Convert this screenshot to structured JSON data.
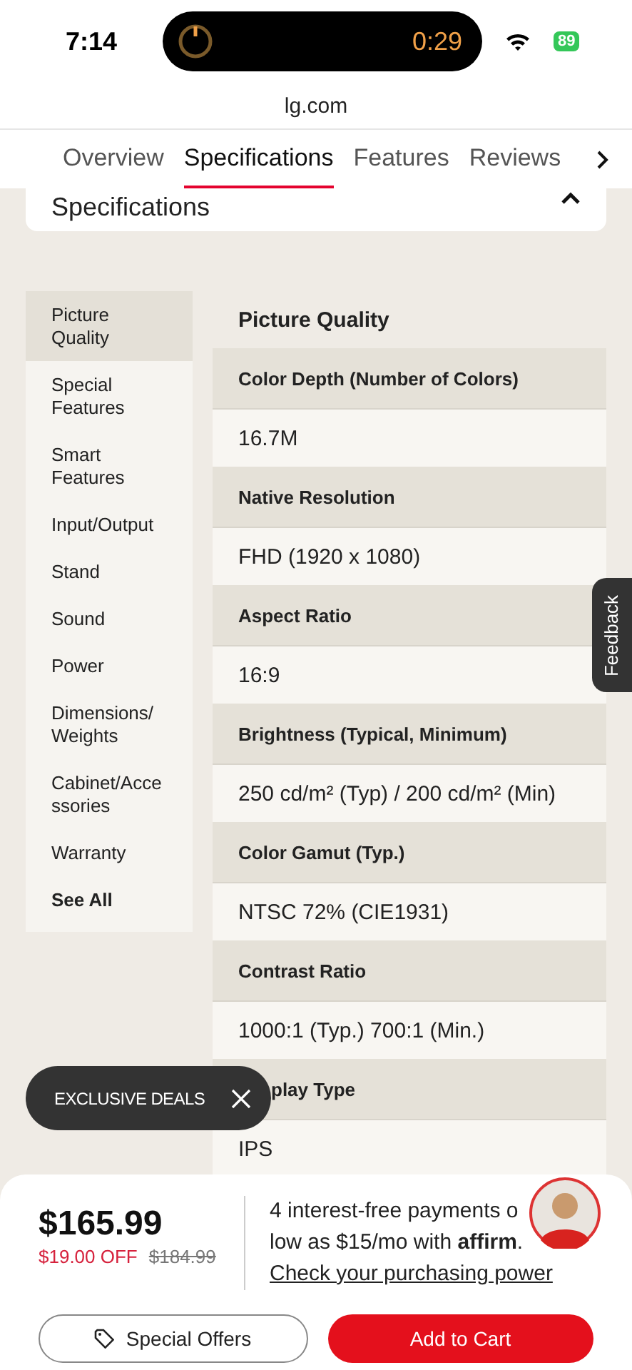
{
  "status_bar": {
    "time": "7:14",
    "timer": "0:29",
    "battery": "89"
  },
  "address_bar": {
    "url": "lg.com"
  },
  "tabs": [
    {
      "label": "Overview",
      "selected": false
    },
    {
      "label": "Specifications",
      "selected": true
    },
    {
      "label": "Features",
      "selected": false
    },
    {
      "label": "Reviews",
      "selected": false
    }
  ],
  "section": {
    "title": "Specifications",
    "expanded": true
  },
  "sidebar": {
    "items": [
      {
        "label": "Picture Quality",
        "selected": true,
        "kind": "category"
      },
      {
        "label": "Special Features",
        "selected": false,
        "kind": "category"
      },
      {
        "label": "Smart Features",
        "selected": false,
        "kind": "category"
      },
      {
        "label": "Input/Output",
        "selected": false,
        "kind": "category"
      },
      {
        "label": "Stand",
        "selected": false,
        "kind": "category"
      },
      {
        "label": "Sound",
        "selected": false,
        "kind": "category"
      },
      {
        "label": "Power",
        "selected": false,
        "kind": "category"
      },
      {
        "label": "Dimensions/ Weights",
        "selected": false,
        "kind": "category"
      },
      {
        "label": "Cabinet/Accessories",
        "selected": false,
        "kind": "category"
      },
      {
        "label": "Warranty",
        "selected": false,
        "kind": "category"
      },
      {
        "label": "See All",
        "selected": false,
        "kind": "link"
      }
    ]
  },
  "specs": {
    "title": "Picture Quality",
    "rows": [
      {
        "label": "Color Depth (Number of Colors)",
        "value": "16.7M"
      },
      {
        "label": "Native Resolution",
        "value": "FHD (1920 x 1080)"
      },
      {
        "label": "Aspect Ratio",
        "value": "16:9"
      },
      {
        "label": "Brightness (Typical, Minimum)",
        "value": "250 cd/m² (Typ) / 200 cd/m² (Min)"
      },
      {
        "label": "Color Gamut (Typ.)",
        "value": "NTSC 72% (CIE1931)"
      },
      {
        "label": "Contrast Ratio",
        "value": "1000:1 (Typ.) 700:1 (Min.)"
      },
      {
        "label": "play Type",
        "value": "IPS",
        "partly_hidden": true
      }
    ]
  },
  "feedback_tab": "Feedback",
  "deals_pill": {
    "label": "EXCLUSIVE DEALS"
  },
  "purchase": {
    "price": "$165.99",
    "discount": "$19.00 OFF",
    "original_price": "$184.99",
    "affirm_lines": [
      "4 interest-free payments o",
      "low as $15/mo with **affirm**."
    ],
    "affirm_link": "Check your purchasing power",
    "offers_button": "Special Offers",
    "cart_button": "Add to Cart"
  }
}
